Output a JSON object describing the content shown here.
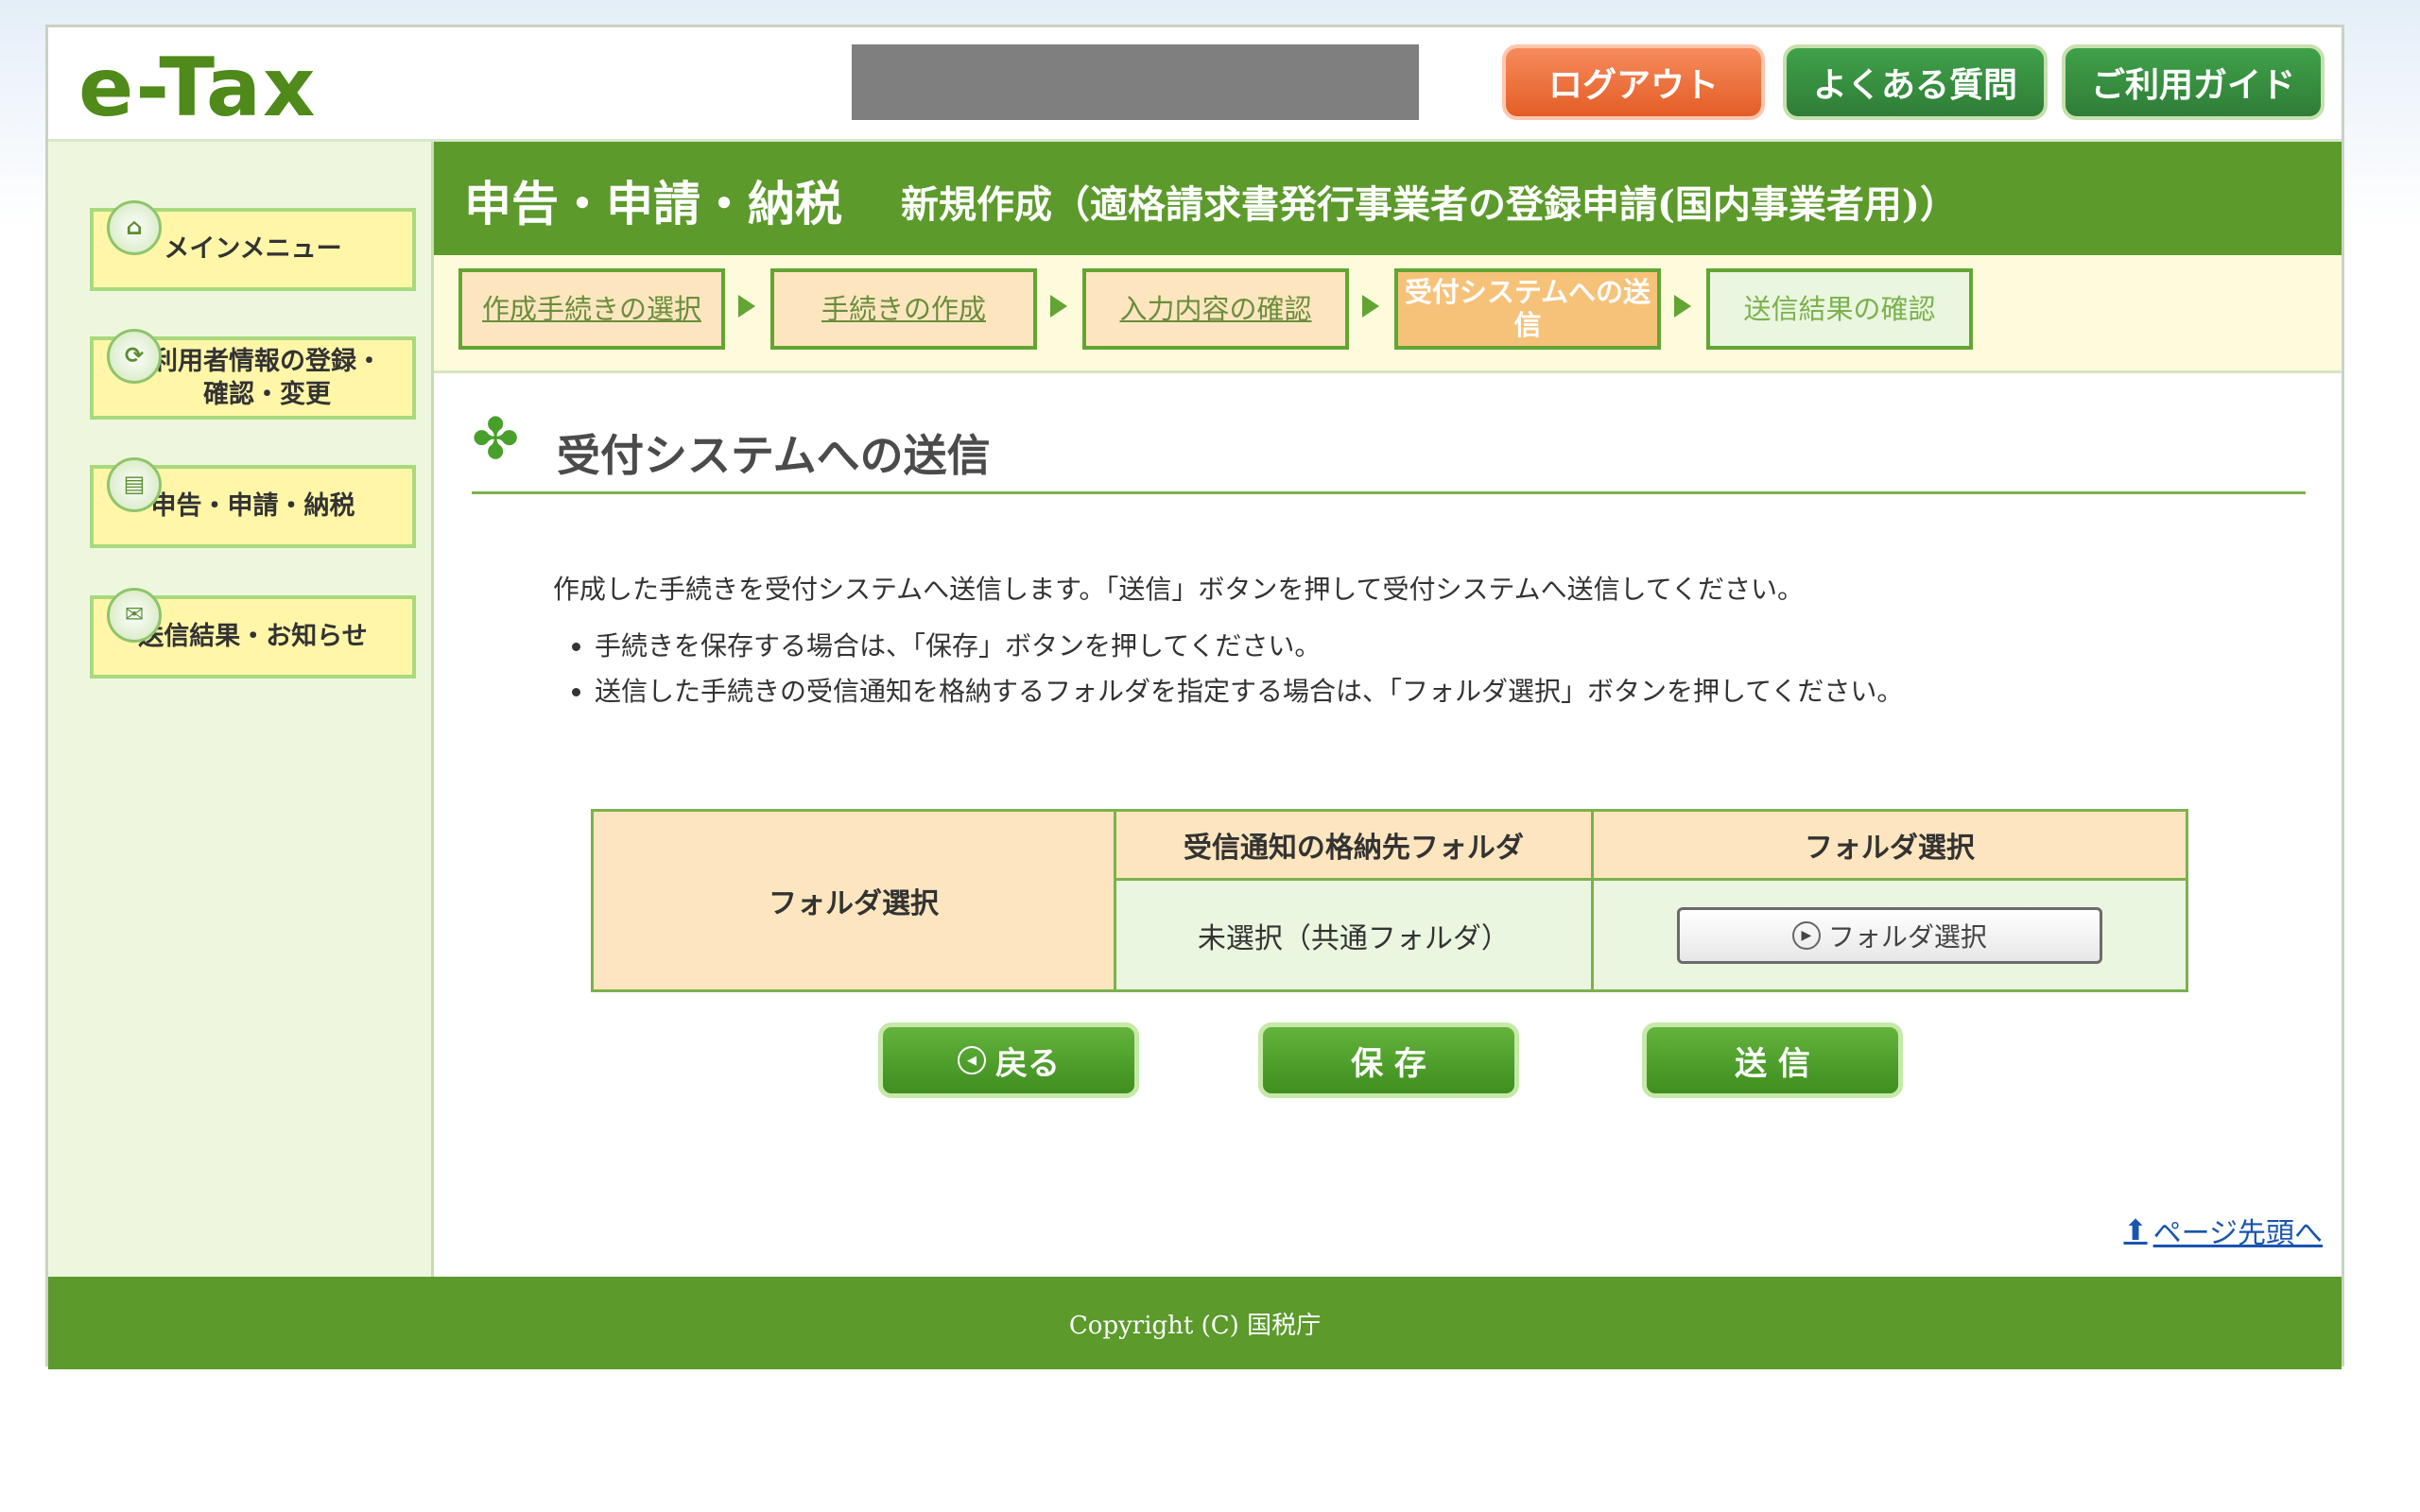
{
  "header": {
    "logo": "e-Tax",
    "buttons": {
      "logout": "ログアウト",
      "faq": "よくある質問",
      "guide": "ご利用ガイド"
    }
  },
  "sidebar": {
    "items": [
      {
        "label": "メインメニュー",
        "icon": "home-icon"
      },
      {
        "label": "利用者情報の登録・確認・変更",
        "icon": "user-settings-icon"
      },
      {
        "label": "申告・申請・納税",
        "icon": "document-icon"
      },
      {
        "label": "送信結果・お知らせ",
        "icon": "mail-icon"
      }
    ]
  },
  "page": {
    "title": "申告・申請・納税",
    "subtitle": "新規作成（適格請求書発行事業者の登録申請(国内事業者用)）",
    "steps": [
      {
        "label": "作成手続きの選択",
        "state": "done"
      },
      {
        "label": "手続きの作成",
        "state": "done"
      },
      {
        "label": "入力内容の確認",
        "state": "done"
      },
      {
        "label": "受付システムへの送信",
        "state": "active"
      },
      {
        "label": "送信結果の確認",
        "state": "future"
      }
    ],
    "section_title": "受付システムへの送信",
    "intro": "作成した手続きを受付システムへ送信します。「送信」ボタンを押して受付システムへ送信してください。",
    "bullets": [
      "手続きを保存する場合は、「保存」ボタンを押してください。",
      "送信した手続きの受信通知を格納するフォルダを指定する場合は、「フォルダ選択」ボタンを押してください。"
    ],
    "table": {
      "row_header": "フォルダ選択",
      "col_headers": [
        "受信通知の格納先フォルダ",
        "フォルダ選択"
      ],
      "folder_value": "未選択（共通フォルダ）",
      "folder_button": "フォルダ選択"
    },
    "actions": {
      "back": "戻る",
      "save": "保 存",
      "send": "送 信"
    },
    "page_top": "ページ先頭へ"
  },
  "footer": {
    "copyright": "Copyright (C) 国税庁"
  },
  "colors": {
    "green": "#5c9a2c",
    "logout": "#e35d25",
    "step_bg": "#fde6bf",
    "sidebar_item": "#fff6a8"
  }
}
